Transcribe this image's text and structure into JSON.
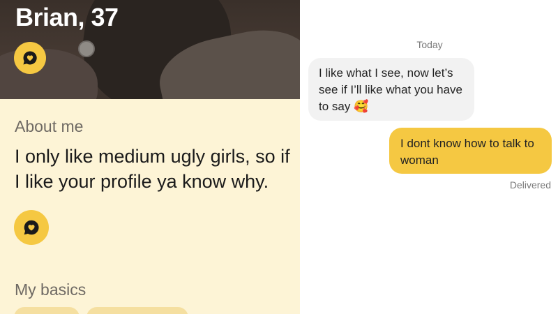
{
  "profile": {
    "name_age": "Brian, 37",
    "about": {
      "title": "About me",
      "text": "I only like medium ugly girls, so if I like your profile ya know why."
    },
    "basics": {
      "title": "My basics"
    },
    "icons": {
      "comment": "speech-bubble-heart-icon"
    }
  },
  "chat": {
    "day_label": "Today",
    "messages": [
      {
        "direction": "received",
        "text": "I like what I see, now let’s see if I’ll like what you have to say 🥰"
      },
      {
        "direction": "sent",
        "text": "I dont know how to talk to woman"
      }
    ],
    "status": "Delivered"
  },
  "colors": {
    "accent": "#f5c842",
    "profile_background": "#fdf4d6",
    "received_bubble": "#f2f2f2"
  }
}
